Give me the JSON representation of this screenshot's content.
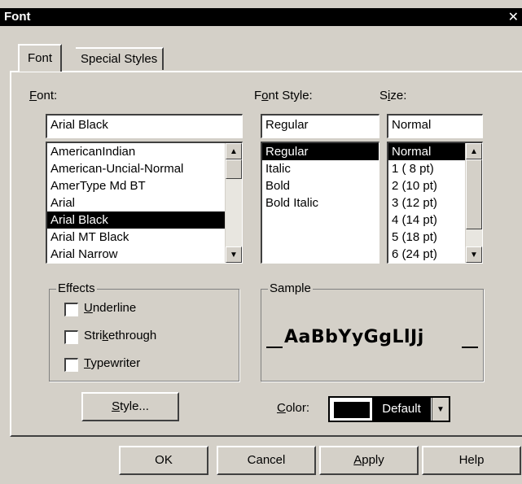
{
  "window": {
    "title": "Font",
    "close_glyph": "✕"
  },
  "tabs": [
    {
      "label": "Font",
      "active": true
    },
    {
      "label": "Special Styles",
      "active": false
    }
  ],
  "font": {
    "label": "Font:",
    "value": "Arial Black",
    "items": [
      "AmericanIndian",
      "American-Uncial-Normal",
      "AmerType Md BT",
      "Arial",
      "Arial Black",
      "Arial MT Black",
      "Arial Narrow"
    ],
    "selected_index": 4
  },
  "font_style": {
    "label": "Font Style:",
    "value": "Regular",
    "items": [
      "Regular",
      "Italic",
      "Bold",
      "Bold Italic"
    ],
    "selected_index": 0
  },
  "size": {
    "label": "Size:",
    "value": "Normal",
    "items": [
      "Normal",
      "1  ( 8 pt)",
      "2  (10 pt)",
      "3  (12 pt)",
      "4  (14 pt)",
      "5  (18 pt)",
      "6  (24 pt)"
    ],
    "selected_index": 0
  },
  "effects": {
    "title": "Effects",
    "underline": "Underline",
    "strikethrough": "Strikethrough",
    "typewriter": "Typewriter"
  },
  "sample": {
    "title": "Sample",
    "text": "AaBbYyGgLlJj"
  },
  "style_button": "Style...",
  "color": {
    "label": "Color:",
    "value": "Default",
    "swatch": "#000000"
  },
  "buttons": {
    "ok": "OK",
    "cancel": "Cancel",
    "apply": "Apply",
    "help": "Help"
  }
}
